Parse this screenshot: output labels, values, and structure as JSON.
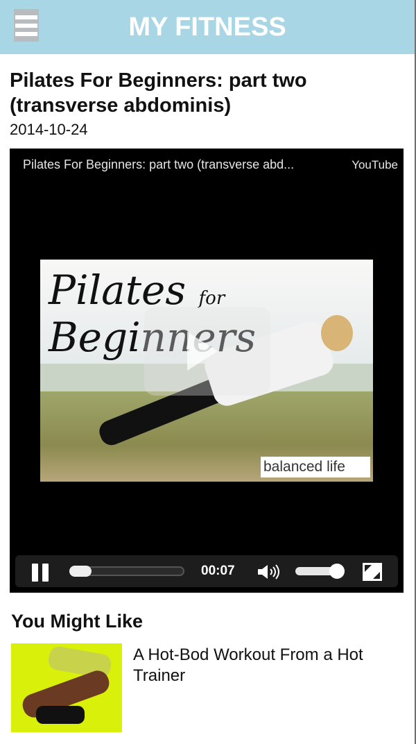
{
  "header": {
    "title": "MY FITNESS",
    "menu_icon": "hamburger-menu-icon",
    "bar_color": "#a9d6e5"
  },
  "post": {
    "title": "Pilates For Beginners: part two (transverse abdominis)",
    "date": "2014-10-24"
  },
  "video": {
    "title": "Pilates For Beginners: part two (transverse abd...",
    "source_label": "YouTube",
    "thumbnail": {
      "headline_main": "Pilates",
      "headline_for": "for",
      "headline_end": "Beginners",
      "brand": "balanced life"
    },
    "controls": {
      "time": "00:07",
      "seek_progress_fraction": 0.1,
      "volume_fraction": 0.9,
      "pause_icon": "pause-icon",
      "volume_icon": "volume-icon",
      "fullscreen_icon": "fullscreen-icon"
    }
  },
  "related": {
    "section_title": "You Might Like",
    "items": [
      {
        "title": "A Hot-Bod Workout From a Hot Trainer"
      }
    ]
  }
}
